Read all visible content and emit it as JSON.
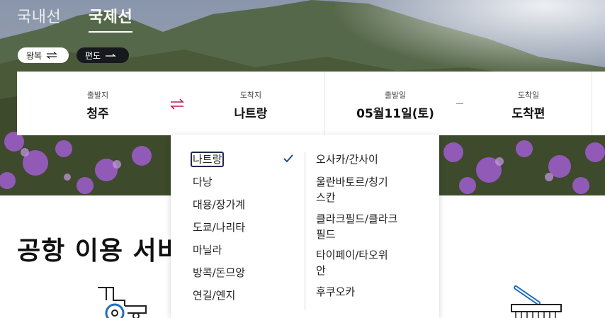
{
  "trip_tabs": {
    "domestic": "국내선",
    "international": "국제선"
  },
  "trip_type": {
    "roundtrip_label": "왕복",
    "roundtrip_icon": "swap-arrows-icon",
    "oneway_label": "편도",
    "oneway_icon": "right-arrow-icon"
  },
  "booking": {
    "origin": {
      "label": "출발지",
      "value": "청주"
    },
    "destination": {
      "label": "도착지",
      "value": "나트랑"
    },
    "departure_date": {
      "label": "출발일",
      "value": "05월11일(토)"
    },
    "arrival_date": {
      "label": "도착일",
      "value": "도착편"
    },
    "swap_icon": "swap-arrows-icon"
  },
  "section": {
    "title": "공항 이용 서비"
  },
  "dropdown": {
    "left_column": [
      {
        "label": "나트랑",
        "selected": true
      },
      {
        "label": "다낭"
      },
      {
        "label": "대용/장가계"
      },
      {
        "label": "도쿄/나리타"
      },
      {
        "label": "마닐라"
      },
      {
        "label": "방콕/돈므앙"
      },
      {
        "label": "연길/옌지"
      }
    ],
    "right_column": [
      {
        "lines": [
          "오사카/간사이"
        ]
      },
      {
        "lines": [
          "울란바토르/칭기",
          "스칸"
        ]
      },
      {
        "lines": [
          "클라크필드/클라크",
          "필드"
        ]
      },
      {
        "lines": [
          "타이페이/타오위",
          "안"
        ]
      },
      {
        "lines": [
          "후쿠오카"
        ]
      }
    ],
    "check_icon": "checkmark-icon"
  },
  "colors": {
    "accent_swap": "#b3245a",
    "check": "#1f4e8c",
    "service_icon": "#1f6fbf"
  }
}
